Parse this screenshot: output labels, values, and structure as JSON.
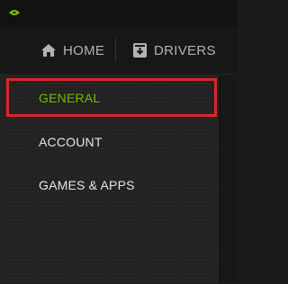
{
  "topnav": {
    "home_label": "HOME",
    "drivers_label": "DRIVERS"
  },
  "sidebar": {
    "items": [
      {
        "label": "GENERAL",
        "active": true
      },
      {
        "label": "ACCOUNT",
        "active": false
      },
      {
        "label": "GAMES & APPS",
        "active": false
      }
    ]
  },
  "colors": {
    "accent": "#76b900",
    "highlight": "#d9262f",
    "background": "#1b1b1b"
  },
  "icons": [
    "nvidia-logo-icon",
    "home-icon",
    "drivers-icon"
  ]
}
